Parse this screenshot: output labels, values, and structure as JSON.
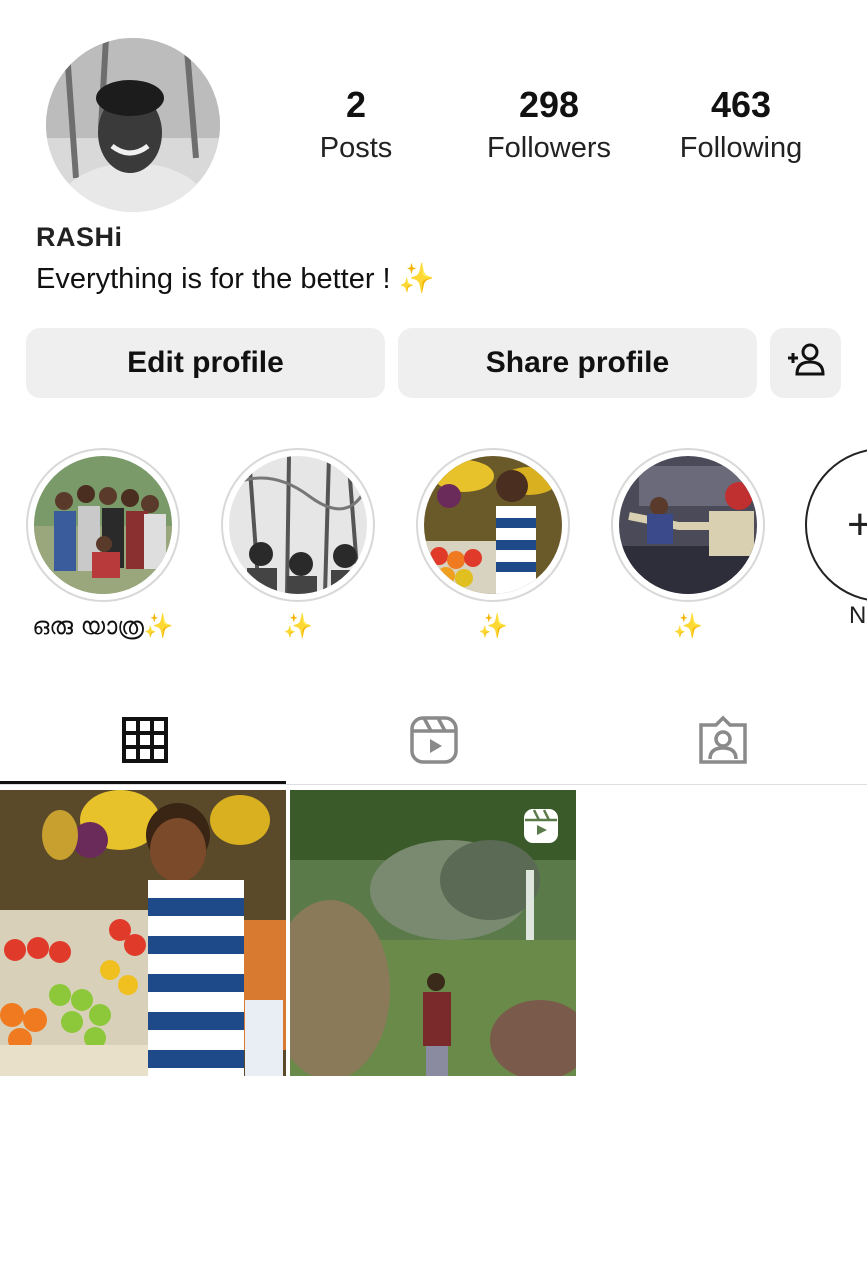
{
  "profile": {
    "username": "RASHi",
    "bio_text": "Everything is for the better !",
    "bio_emoji": "✨"
  },
  "stats": {
    "posts": {
      "count": "2",
      "label": "Posts"
    },
    "followers": {
      "count": "298",
      "label": "Followers"
    },
    "following": {
      "count": "463",
      "label": "Following"
    }
  },
  "buttons": {
    "edit_label": "Edit profile",
    "share_label": "Share profile",
    "add_icon": "add-person-icon"
  },
  "highlights": [
    {
      "label": "ഒരു യാത്ര",
      "emoji": "✨"
    },
    {
      "label": "",
      "emoji": "✨"
    },
    {
      "label": "",
      "emoji": "✨"
    },
    {
      "label": "",
      "emoji": "✨"
    },
    {
      "label": "N",
      "emoji": ""
    }
  ],
  "tabs": [
    {
      "icon": "grid-icon",
      "active": true
    },
    {
      "icon": "reels-icon",
      "active": false
    },
    {
      "icon": "tagged-icon",
      "active": false
    }
  ],
  "posts": [
    {
      "type": "photo",
      "icon": ""
    },
    {
      "type": "reel",
      "icon": "reel-icon"
    }
  ],
  "colors": {
    "background": "#ffffff",
    "button_bg": "#efefef",
    "sparkle": "#f2c230",
    "text": "#111111"
  }
}
